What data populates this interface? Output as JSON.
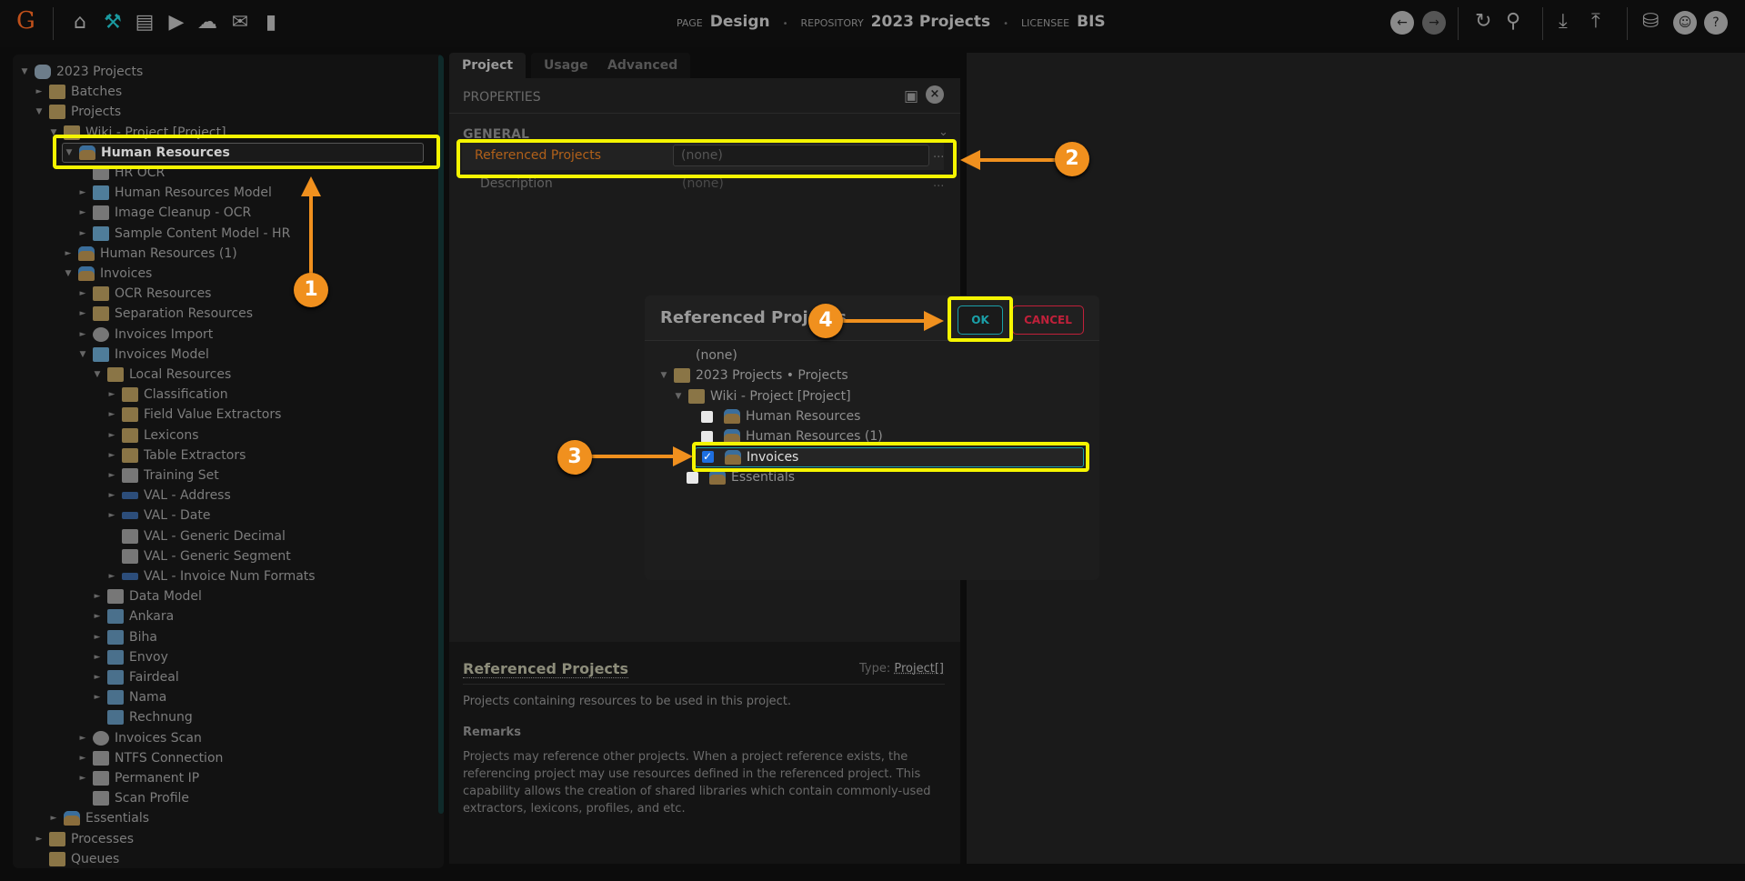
{
  "header": {
    "logo": "G",
    "nav_icons": [
      "home-icon",
      "tools-icon",
      "archive-icon",
      "media-icon",
      "cloud-upload-icon",
      "briefcase-icon",
      "chart-icon"
    ],
    "page_label": "PAGE",
    "page": "Design",
    "repository_label": "REPOSITORY",
    "repository": "2023 Projects",
    "licensee_label": "LICENSEE",
    "licensee": "BIS"
  },
  "tree": [
    {
      "label": "2023 Projects",
      "level": 0,
      "toggle": "open",
      "icon": "db"
    },
    {
      "label": "Batches",
      "level": 1,
      "toggle": "closed",
      "icon": "folder"
    },
    {
      "label": "Projects",
      "level": 1,
      "toggle": "open",
      "icon": "folder"
    },
    {
      "label": "Wiki - Project [Project]",
      "level": 2,
      "toggle": "open",
      "icon": "folder"
    },
    {
      "label": "Human Resources",
      "level": 3,
      "toggle": "open",
      "icon": "proj",
      "selected": true
    },
    {
      "label": "HR OCR",
      "level": 4,
      "toggle": "",
      "icon": "doc"
    },
    {
      "label": "Human Resources Model",
      "level": 4,
      "toggle": "closed",
      "icon": "model"
    },
    {
      "label": "Image Cleanup - OCR",
      "level": 4,
      "toggle": "closed",
      "icon": "doc"
    },
    {
      "label": "Sample Content Model - HR",
      "level": 4,
      "toggle": "closed",
      "icon": "model"
    },
    {
      "label": "Human Resources (1)",
      "level": 3,
      "toggle": "closed",
      "icon": "proj"
    },
    {
      "label": "Invoices",
      "level": 3,
      "toggle": "open",
      "icon": "proj"
    },
    {
      "label": "OCR Resources",
      "level": 4,
      "toggle": "closed",
      "icon": "folder"
    },
    {
      "label": "Separation Resources",
      "level": 4,
      "toggle": "closed",
      "icon": "folder"
    },
    {
      "label": "Invoices Import",
      "level": 4,
      "toggle": "closed",
      "icon": "gear"
    },
    {
      "label": "Invoices Model",
      "level": 4,
      "toggle": "open",
      "icon": "model"
    },
    {
      "label": "Local Resources",
      "level": 5,
      "toggle": "open",
      "icon": "folder"
    },
    {
      "label": "Classification",
      "level": 6,
      "toggle": "closed",
      "icon": "folder"
    },
    {
      "label": "Field Value Extractors",
      "level": 6,
      "toggle": "closed",
      "icon": "folder"
    },
    {
      "label": "Lexicons",
      "level": 6,
      "toggle": "closed",
      "icon": "folder"
    },
    {
      "label": "Table Extractors",
      "level": 6,
      "toggle": "closed",
      "icon": "folder"
    },
    {
      "label": "Training Set",
      "level": 6,
      "toggle": "closed",
      "icon": "doc"
    },
    {
      "label": "VAL - Address",
      "level": 6,
      "toggle": "closed",
      "icon": "val"
    },
    {
      "label": "VAL - Date",
      "level": 6,
      "toggle": "closed",
      "icon": "val"
    },
    {
      "label": "VAL - Generic Decimal",
      "level": 6,
      "toggle": "",
      "icon": "doc"
    },
    {
      "label": "VAL - Generic Segment",
      "level": 6,
      "toggle": "",
      "icon": "doc"
    },
    {
      "label": "VAL - Invoice Num Formats",
      "level": 6,
      "toggle": "closed",
      "icon": "val"
    },
    {
      "label": "Data Model",
      "level": 5,
      "toggle": "closed",
      "icon": "doc"
    },
    {
      "label": "Ankara",
      "level": 5,
      "toggle": "closed",
      "icon": "pages"
    },
    {
      "label": "Biha",
      "level": 5,
      "toggle": "closed",
      "icon": "pages"
    },
    {
      "label": "Envoy",
      "level": 5,
      "toggle": "closed",
      "icon": "pages"
    },
    {
      "label": "Fairdeal",
      "level": 5,
      "toggle": "closed",
      "icon": "pages"
    },
    {
      "label": "Nama",
      "level": 5,
      "toggle": "closed",
      "icon": "pages"
    },
    {
      "label": "Rechnung",
      "level": 5,
      "toggle": "",
      "icon": "pages"
    },
    {
      "label": "Invoices Scan",
      "level": 4,
      "toggle": "closed",
      "icon": "gear"
    },
    {
      "label": "NTFS Connection",
      "level": 4,
      "toggle": "closed",
      "icon": "doc"
    },
    {
      "label": "Permanent IP",
      "level": 4,
      "toggle": "closed",
      "icon": "doc"
    },
    {
      "label": "Scan Profile",
      "level": 4,
      "toggle": "",
      "icon": "doc"
    },
    {
      "label": "Essentials",
      "level": 2,
      "toggle": "closed",
      "icon": "proj"
    },
    {
      "label": "Processes",
      "level": 1,
      "toggle": "closed",
      "icon": "folder"
    },
    {
      "label": "Queues",
      "level": 1,
      "toggle": "",
      "icon": "folder"
    }
  ],
  "tabs": [
    "Project",
    "Usage",
    "Advanced"
  ],
  "properties": {
    "title": "PROPERTIES",
    "section": "GENERAL",
    "fields": [
      {
        "label": "Referenced Projects",
        "value": "(none)"
      },
      {
        "label": "Description",
        "value": "(none)"
      }
    ],
    "ellipsis": "..."
  },
  "help": {
    "title": "Referenced Projects",
    "type_label": "Type:",
    "type_value": "Project[]",
    "summary": "Projects containing resources to be used in this project.",
    "remarks_title": "Remarks",
    "remarks": "Projects may reference other projects. When a project reference exists, the referencing project may use resources defined in the referenced project. This capability allows the creation of shared libraries which contain commonly-used extractors, lexicons, profiles, and etc."
  },
  "dialog": {
    "title": "Referenced Projects",
    "ok": "OK",
    "cancel": "CANCEL",
    "none": "(none)",
    "root": "2023 Projects • Projects",
    "folder": "Wiki - Project [Project]",
    "items": [
      {
        "label": "Human Resources",
        "checked": false,
        "level": 2
      },
      {
        "label": "Human Resources (1)",
        "checked": false,
        "level": 2
      },
      {
        "label": "Invoices",
        "checked": true,
        "level": 2
      },
      {
        "label": "Essentials",
        "checked": false,
        "level": 1
      }
    ]
  },
  "annotations": [
    "1",
    "2",
    "3",
    "4"
  ],
  "colors": {
    "accent": "#f0901e",
    "highlight": "#f5f500",
    "ok": "#1aa0a8",
    "cancel": "#c0203a",
    "field_label": "#b0601a"
  }
}
